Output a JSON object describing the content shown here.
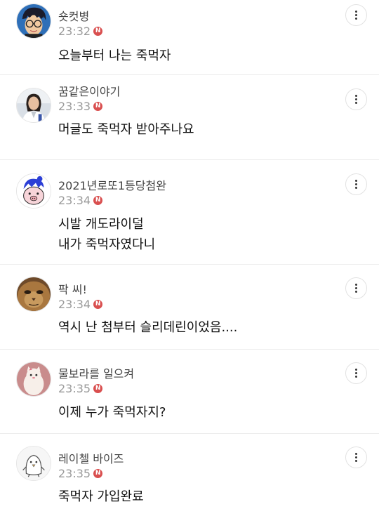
{
  "comments": [
    {
      "author": "숏컷병",
      "time": "23:32",
      "badge": "N",
      "text": "오늘부터 나는 죽먹자",
      "avatar": "anime-glasses-avatar"
    },
    {
      "author": "꿈같은이야기",
      "time": "23:33",
      "badge": "N",
      "text": "머글도 죽먹자 받아주나요",
      "avatar": "woman-photo-avatar"
    },
    {
      "author": "2021년로또1등당첨완",
      "time": "23:34",
      "badge": "N",
      "text": "시발 개도라이덜\n내가 죽먹자였다니",
      "avatar": "cartoon-pig-avatar"
    },
    {
      "author": "팍 씨!",
      "time": "23:34",
      "badge": "N",
      "text": "역시 난 첨부터 슬리데린이었음....",
      "avatar": "cat-face-avatar"
    },
    {
      "author": "물보라를 일으켜",
      "time": "23:35",
      "badge": "N",
      "text": "이제 누가 죽먹자지?",
      "avatar": "white-cat-plush-avatar"
    },
    {
      "author": "레이첼 바이즈",
      "time": "23:35",
      "badge": "N",
      "text": "죽먹자 가입완료",
      "avatar": "penguin-doodle-avatar"
    }
  ],
  "colors": {
    "badge": "#d94f4f",
    "divider": "#ececec",
    "time": "#9a9a9a"
  },
  "icons": {
    "more": "vertical-ellipsis-icon",
    "new": "new-badge-icon"
  }
}
